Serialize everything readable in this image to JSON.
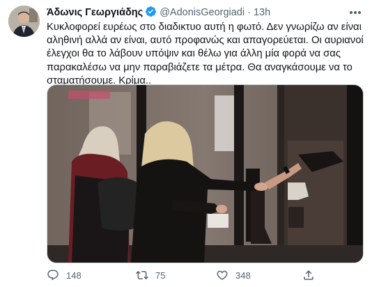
{
  "author": {
    "name": "Άδωνις Γεωργιάδης",
    "handle": "@AdonisGeorgiadi",
    "separator": "·",
    "time": "13h",
    "verified_icon": "verified-badge-icon"
  },
  "tweet": {
    "lines": [
      "Κυκλοφορεί ευρέως στο διαδικτυο αυτή η φωτό. Δεν γνωρίζω αν είναι",
      "αληθινή αλλά αν είναι, αυτό προφανώς και απαγορεύεται. Οι αυριανοί",
      "έλεγχοι θα το λάβουν υπόψιν και θέλω για άλλη μία φορά να σας",
      "παρακαλέσω να μην παραβιάζετε τα μέτρα. Θα αναγκάσουμε να το",
      "σταματήσουμε. Κρίμα.."
    ]
  },
  "actions": {
    "reply": {
      "icon": "reply-icon",
      "count": "148"
    },
    "retweet": {
      "icon": "retweet-icon",
      "count": "75"
    },
    "like": {
      "icon": "heart-icon",
      "count": "348"
    },
    "share": {
      "icon": "share-icon",
      "count": ""
    }
  },
  "colors": {
    "accent": "#1d9bf0",
    "text": "#0f1419",
    "secondary": "#536471",
    "border": "#cfd9de"
  }
}
